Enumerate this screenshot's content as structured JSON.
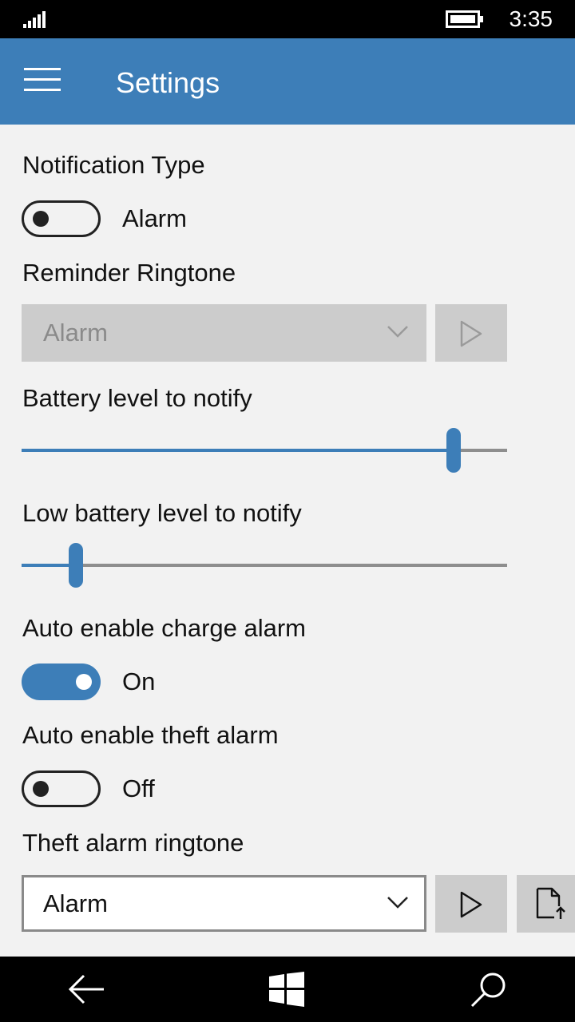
{
  "status_bar": {
    "time": "3:35",
    "signal_icon": "signal-bars-icon",
    "battery_icon": "battery-icon"
  },
  "header": {
    "title": "Settings",
    "menu_icon": "hamburger-menu-icon",
    "background_color": "#3d7eb8"
  },
  "settings": {
    "notification_type": {
      "label": "Notification Type",
      "state": "off",
      "state_label": "Alarm"
    },
    "reminder_ringtone": {
      "label": "Reminder Ringtone",
      "selected": "Alarm",
      "enabled": false,
      "play_icon": "play-icon"
    },
    "battery_level": {
      "label": "Battery level to notify",
      "value_fraction": 0.889
    },
    "low_battery_level": {
      "label": "Low battery level to notify",
      "value_fraction": 0.112
    },
    "auto_charge_alarm": {
      "label": "Auto enable charge alarm",
      "state": "on",
      "state_label": "On"
    },
    "auto_theft_alarm": {
      "label": "Auto enable theft alarm",
      "state": "off",
      "state_label": "Off"
    },
    "theft_ringtone": {
      "label": "Theft alarm ringtone",
      "selected": "Alarm",
      "enabled": true,
      "play_icon": "play-icon",
      "file_icon": "file-upload-icon"
    }
  },
  "nav_bar": {
    "back_icon": "back-arrow-icon",
    "home_icon": "windows-start-icon",
    "search_icon": "search-icon"
  },
  "colors": {
    "accent": "#3d7eb8",
    "background": "#f2f2f2",
    "disabled_control": "#cccccc"
  }
}
